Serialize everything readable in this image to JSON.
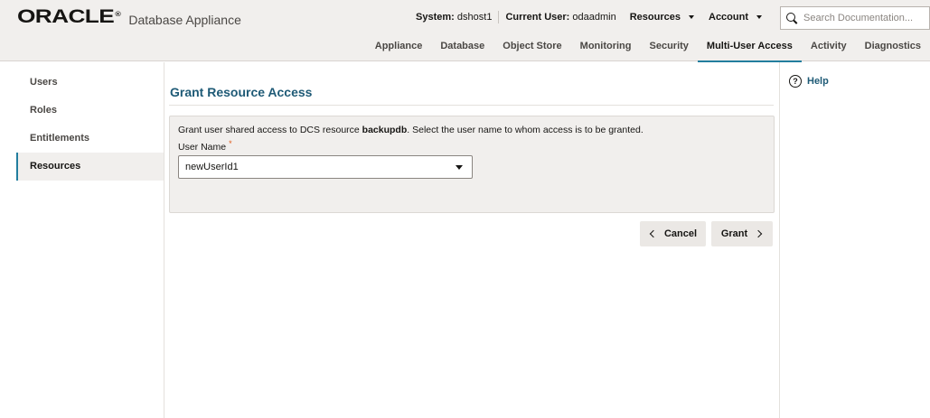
{
  "brand": {
    "logo_text": "ORACLE",
    "logo_mark": "®",
    "product": "Database Appliance"
  },
  "topbar": {
    "system_label": "System:",
    "system_value": "dshost1",
    "user_label": "Current User:",
    "user_value": "odaadmin",
    "resources_menu": "Resources",
    "account_menu": "Account",
    "search_placeholder": "Search Documentation..."
  },
  "nav": {
    "tabs": [
      {
        "label": "Appliance"
      },
      {
        "label": "Database"
      },
      {
        "label": "Object Store"
      },
      {
        "label": "Monitoring"
      },
      {
        "label": "Security"
      },
      {
        "label": "Multi-User Access",
        "active": true
      },
      {
        "label": "Activity"
      },
      {
        "label": "Diagnostics"
      }
    ]
  },
  "sidebar": {
    "items": [
      {
        "label": "Users"
      },
      {
        "label": "Roles"
      },
      {
        "label": "Entitlements"
      },
      {
        "label": "Resources",
        "active": true
      }
    ]
  },
  "main": {
    "title": "Grant Resource Access",
    "description_prefix": "Grant user shared access to DCS resource ",
    "resource_name": "backupdb",
    "description_suffix": ". Select the user name to whom access is to be granted.",
    "field_label": "User Name",
    "required_mark": "*",
    "selected_user": "newUserId1",
    "cancel_label": "Cancel",
    "grant_label": "Grant"
  },
  "help": {
    "icon_glyph": "?",
    "label": "Help"
  },
  "icons": {
    "search": "search-icon",
    "help": "help-circle-icon",
    "dropdown": "chevron-down-icon",
    "cancel": "chevron-left-icon",
    "grant": "chevron-right-icon"
  },
  "colors": {
    "accent": "#227e9e",
    "title": "#1e5a76",
    "header_bg": "#f1efed",
    "required": "#e05a1a"
  }
}
